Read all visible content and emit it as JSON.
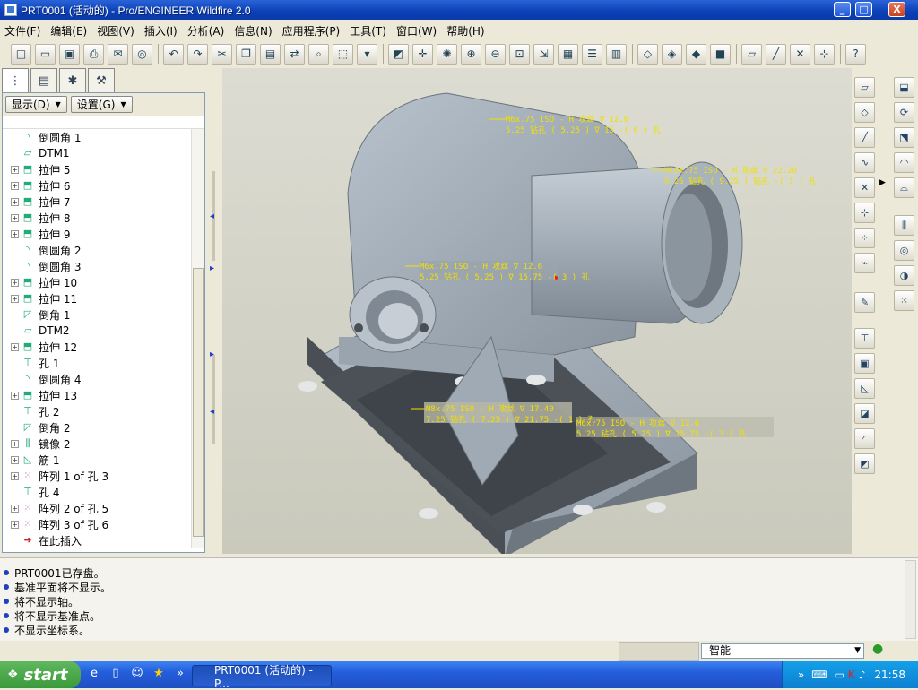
{
  "window": {
    "title": "PRT0001 (活动的) - Pro/ENGINEER Wildfire 2.0",
    "min_label": "_",
    "max_label": "□",
    "close_label": "X"
  },
  "menu": [
    "文件(F)",
    "编辑(E)",
    "视图(V)",
    "插入(I)",
    "分析(A)",
    "信息(N)",
    "应用程序(P)",
    "工具(T)",
    "窗口(W)",
    "帮助(H)"
  ],
  "nav": {
    "show_label": "显示(D)",
    "settings_label": "设置(G)"
  },
  "tree": [
    {
      "label": "倒圆角 1",
      "expand": false,
      "icon": "round-icon"
    },
    {
      "label": "DTM1",
      "expand": false,
      "icon": "datum-plane-icon"
    },
    {
      "label": "拉伸 5",
      "expand": true,
      "icon": "extrude-icon"
    },
    {
      "label": "拉伸 6",
      "expand": true,
      "icon": "extrude-icon"
    },
    {
      "label": "拉伸 7",
      "expand": true,
      "icon": "extrude-icon"
    },
    {
      "label": "拉伸 8",
      "expand": true,
      "icon": "extrude-icon"
    },
    {
      "label": "拉伸 9",
      "expand": true,
      "icon": "extrude-icon"
    },
    {
      "label": "倒圆角 2",
      "expand": false,
      "icon": "round-icon"
    },
    {
      "label": "倒圆角 3",
      "expand": false,
      "icon": "round-icon"
    },
    {
      "label": "拉伸 10",
      "expand": true,
      "icon": "extrude-icon"
    },
    {
      "label": "拉伸 11",
      "expand": true,
      "icon": "extrude-icon"
    },
    {
      "label": "倒角 1",
      "expand": false,
      "icon": "chamfer-icon"
    },
    {
      "label": "DTM2",
      "expand": false,
      "icon": "datum-plane-icon"
    },
    {
      "label": "拉伸 12",
      "expand": true,
      "icon": "extrude-icon"
    },
    {
      "label": "孔 1",
      "expand": false,
      "icon": "hole-icon"
    },
    {
      "label": "倒圆角 4",
      "expand": false,
      "icon": "round-icon"
    },
    {
      "label": "拉伸 13",
      "expand": true,
      "icon": "extrude-icon"
    },
    {
      "label": "孔 2",
      "expand": false,
      "icon": "hole-icon"
    },
    {
      "label": "倒角 2",
      "expand": false,
      "icon": "chamfer-icon"
    },
    {
      "label": "镜像 2",
      "expand": true,
      "icon": "mirror-icon"
    },
    {
      "label": "筋 1",
      "expand": true,
      "icon": "rib-icon"
    },
    {
      "label": "阵列 1 of 孔 3",
      "expand": true,
      "icon": "pattern-icon"
    },
    {
      "label": "孔 4",
      "expand": false,
      "icon": "hole-icon"
    },
    {
      "label": "阵列 2 of 孔 5",
      "expand": true,
      "icon": "pattern-icon"
    },
    {
      "label": "阵列 3 of 孔 6",
      "expand": true,
      "icon": "pattern-icon"
    },
    {
      "label": "在此插入",
      "expand": false,
      "icon": "insert-here-arrow-icon"
    }
  ],
  "annotations": {
    "a1_line1": "M6x.75 ISO - H 攻丝 ∇ 12.6",
    "a1_line2": "5.25 钻孔 ( 5.25 ) ∇ 15  -( 6 ) 孔",
    "a2_line1": "M10x.75 ISO - H 攻丝 ∇ 22.20",
    "a2_line2": "9.25 钻孔 ( 9.25 )  钻孔  -( 1 ) 孔",
    "a3_line1": "M6x.75 ISO - H 攻丝 ∇ 12.6",
    "a3_line2": "5.25 钻孔 ( 5.25 ) ∇ 15.75  -( 3 ) 孔",
    "a4_line1": "M8x.75 ISO - H 攻丝 ∇ 17.40",
    "a4_line2": "7.25 钻孔 ( 7.25 ) ∇ 21.75  -( 1 ) 孔",
    "a5_line1": "M6x.75 ISO - H 攻丝 ∇ 12.6",
    "a5_line2": "5.25 钻孔 ( 5.25 ) ∇ 15.75  -( 3 ) 孔"
  },
  "messages": [
    "PRT0001已存盘。",
    "基准平面将不显示。",
    "将不显示轴。",
    "将不显示基准点。",
    "不显示坐标系。"
  ],
  "status": {
    "filter_value": "智能"
  },
  "taskbar": {
    "start_label": "start",
    "task_label": "PRT0001 (活动的) - P...",
    "clock": "21:58"
  },
  "colors": {
    "title_blue": "#0a3fb6",
    "viewport_bg": "#d2d2c8",
    "model_gray": "#9aa4ae",
    "annotation_yellow": "#f0e000"
  }
}
